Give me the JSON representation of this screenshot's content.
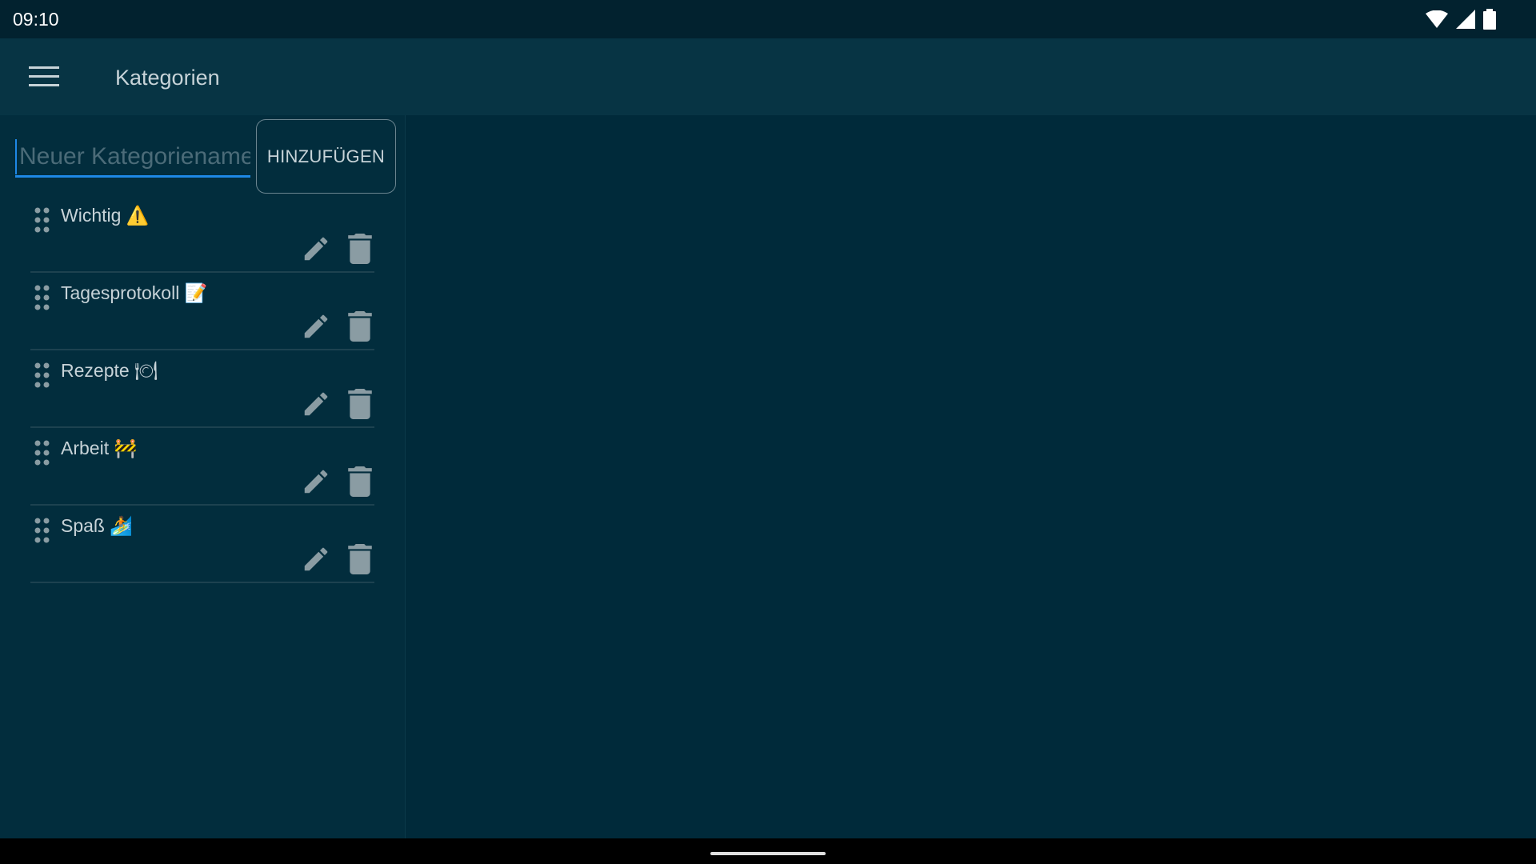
{
  "status_bar": {
    "time": "09:10",
    "icons": [
      "wifi-icon",
      "cell-signal-icon",
      "battery-icon"
    ]
  },
  "app_bar": {
    "title": "Kategorien",
    "menu_icon": "hamburger-menu-icon"
  },
  "new_category": {
    "placeholder": "Neuer Kategoriename",
    "value": "",
    "add_label": "HINZUFÜGEN"
  },
  "categories": [
    {
      "label": "Wichtig",
      "emoji": "⚠️"
    },
    {
      "label": "Tagesprotokoll",
      "emoji": "📝"
    },
    {
      "label": "Rezepte",
      "emoji": "🍽"
    },
    {
      "label": "Arbeit",
      "emoji": "🚧"
    },
    {
      "label": "Spaß",
      "emoji": "🏄"
    }
  ],
  "colors": {
    "background": "#002a3a",
    "app_bar": "#073444",
    "status_bar": "#02222f",
    "accent": "#1e88e5",
    "text": "#c7d3d8",
    "icon": "#8a9ca3"
  }
}
